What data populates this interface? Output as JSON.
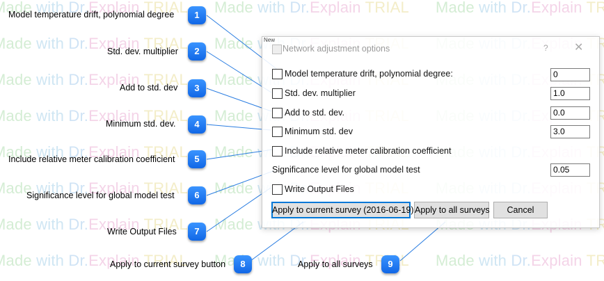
{
  "watermark": {
    "made": "Made",
    "with": "with",
    "dr": "Dr.",
    "explain": "Explain",
    "trial": "TRIAL",
    "text": "Made with Dr.Explain TRIAL"
  },
  "dialog": {
    "corner_text": "New",
    "title": "Network adjustment options",
    "help_glyph": "?",
    "close_glyph": "✕",
    "options": [
      {
        "label": "Model temperature drift, polynomial degree:",
        "value": "0"
      },
      {
        "label": "Std. dev. multiplier",
        "value": "1.0"
      },
      {
        "label": "Add to std. dev.",
        "value": "0.0"
      },
      {
        "label": "Minimum std. dev",
        "value": "3.0"
      },
      {
        "label": "Include relative meter calibration coefficient"
      }
    ],
    "significance": {
      "label": "Significance level for global model test",
      "value": "0.05"
    },
    "write_output": {
      "label": "Write Output Files"
    },
    "buttons": {
      "apply_current": "Apply to current survey (2016-06-19)",
      "apply_all": "Apply to all surveys",
      "cancel": "Cancel"
    }
  },
  "callouts": [
    {
      "number": "1",
      "label": "Model temperature drift, polynomial degree"
    },
    {
      "number": "2",
      "label": "Std. dev. multiplier"
    },
    {
      "number": "3",
      "label": "Add to std. dev"
    },
    {
      "number": "4",
      "label": "Minimum std. dev."
    },
    {
      "number": "5",
      "label": "Include relative meter calibration coefficient"
    },
    {
      "number": "6",
      "label": "Significance level for global model test"
    },
    {
      "number": "7",
      "label": "Write Output Files"
    },
    {
      "number": "8",
      "label": "Apply to current survey button"
    },
    {
      "number": "9",
      "label": "Apply to all surveys"
    }
  ],
  "colors": {
    "callout_blue": "#1a73f0",
    "leader_line": "#2a7de1",
    "primary_button_border": "#0078d7"
  }
}
